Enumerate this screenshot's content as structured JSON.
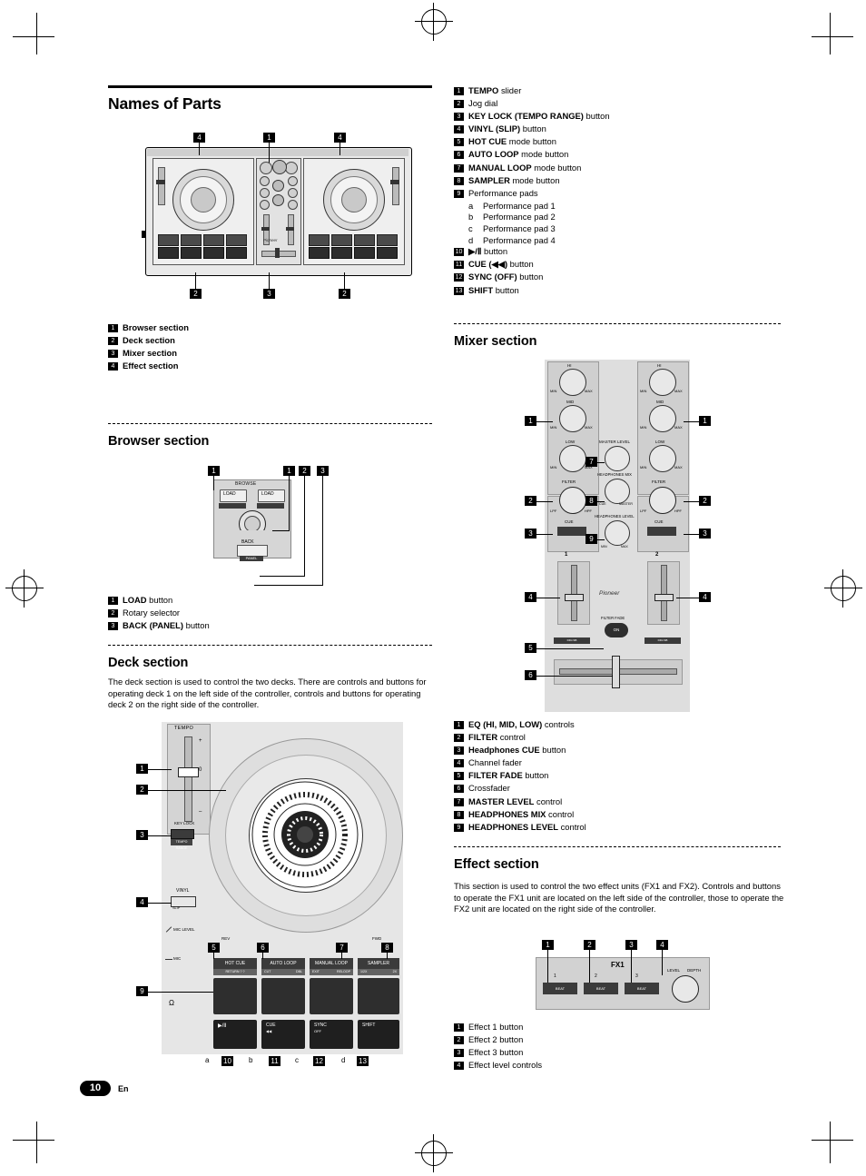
{
  "page": {
    "number": "10",
    "language": "En",
    "title": "Names of Parts"
  },
  "overview": {
    "callouts_top": [
      "4",
      "1",
      "4"
    ],
    "callouts_bottom": [
      "2",
      "3",
      "2"
    ],
    "brand": "Pioneer",
    "items": [
      {
        "num": "1",
        "label": "Browser section"
      },
      {
        "num": "2",
        "label": "Deck section"
      },
      {
        "num": "3",
        "label": "Mixer section"
      },
      {
        "num": "4",
        "label": "Effect section"
      }
    ]
  },
  "browser": {
    "title": "Browser section",
    "callouts": [
      "1",
      "1",
      "2",
      "3"
    ],
    "fig_labels": {
      "browse": "BROWSE",
      "load_left": "LOAD",
      "load_right": "LOAD",
      "back": "BACK",
      "panel": "PANEL"
    },
    "items": [
      {
        "num": "1",
        "bold": "LOAD",
        "rest": " button"
      },
      {
        "num": "2",
        "bold": "",
        "rest": "Rotary selector"
      },
      {
        "num": "3",
        "bold": "BACK (PANEL)",
        "rest": " button"
      }
    ]
  },
  "deck": {
    "title": "Deck section",
    "intro": "The deck section is used to control the two decks. There are controls and buttons for operating deck 1 on the left side of the controller, controls and buttons for operating deck 2 on the right side of the controller.",
    "fig_labels": {
      "tempo": "TEMPO",
      "plus": "+",
      "zero": "0",
      "minus": "–",
      "key_lock": "KEY LOCK",
      "tempo_range": "TEMPO RANGE",
      "vinyl": "VINYL",
      "slip": "SLIP",
      "mic_level": "MIC LEVEL",
      "mic": "MIC",
      "rev": "REV",
      "fwd": "FWD",
      "hot_cue": "HOT CUE",
      "auto_loop": "AUTO LOOP",
      "manual_loop": "MANUAL LOOP",
      "sampler": "SAMPLER",
      "hot_cue_sub": "RETURN ? ?",
      "auto_loop_sub_l": "CUT",
      "auto_loop_sub_r": "DBL",
      "manual_loop_sub_l": "EXIT",
      "manual_loop_sub_r": "RELOOP",
      "sampler_sub_l": "1/2X",
      "sampler_sub_r": "2X",
      "play": "▶/Ⅱ",
      "cue": "CUE",
      "cue_sub": "◀◀",
      "sync": "SYNC",
      "sync_sub": "OFF",
      "shift": "SHIFT",
      "headphone_icon": "Ω"
    },
    "callouts_left": [
      "1",
      "2",
      "3",
      "4",
      "9"
    ],
    "callouts_pads": [
      "5",
      "6",
      "7",
      "8"
    ],
    "callouts_bottom": [
      "a",
      "10",
      "b",
      "11",
      "c",
      "12",
      "d",
      "13"
    ],
    "items": [
      {
        "num": "1",
        "bold": "TEMPO",
        "rest": " slider"
      },
      {
        "num": "2",
        "bold": "",
        "rest": "Jog dial"
      },
      {
        "num": "3",
        "bold": "KEY LOCK (TEMPO RANGE)",
        "rest": " button"
      },
      {
        "num": "4",
        "bold": "VINYL (SLIP)",
        "rest": " button"
      },
      {
        "num": "5",
        "bold": "HOT CUE",
        "rest": " mode button"
      },
      {
        "num": "6",
        "bold": "AUTO LOOP",
        "rest": " mode button"
      },
      {
        "num": "7",
        "bold": "MANUAL LOOP",
        "rest": " mode button"
      },
      {
        "num": "8",
        "bold": "SAMPLER",
        "rest": " mode button"
      },
      {
        "num": "9",
        "bold": "",
        "rest": "Performance pads"
      },
      {
        "num": "10",
        "bold": "▶/Ⅱ",
        "rest": " button"
      },
      {
        "num": "11",
        "bold": "CUE (◀◀)",
        "rest": " button"
      },
      {
        "num": "12",
        "bold": "SYNC (OFF)",
        "rest": " button"
      },
      {
        "num": "13",
        "bold": "SHIFT",
        "rest": " button"
      }
    ],
    "pads_sub": [
      {
        "letter": "a",
        "label": "Performance pad 1"
      },
      {
        "letter": "b",
        "label": "Performance pad 2"
      },
      {
        "letter": "c",
        "label": "Performance pad 3"
      },
      {
        "letter": "d",
        "label": "Performance pad 4"
      }
    ]
  },
  "mixer": {
    "title": "Mixer section",
    "fig_labels": {
      "hi": "HI",
      "mid": "MID",
      "low": "LOW",
      "min": "MIN",
      "max": "MAX",
      "filter": "FILTER",
      "lpf": "LPF",
      "hpf": "HPF",
      "cue": "CUE",
      "master_level": "MASTER LEVEL",
      "headphones_mix": "HEADPHONES MIX",
      "cue_small": "CUE",
      "master_small": "MASTER",
      "headphones_level": "HEADPHONES LEVEL",
      "deck1": "1",
      "deck2": "2",
      "filter_fade": "FILTER FADE",
      "on": "ON",
      "brand": "Pioneer",
      "xfader_left": "DDJ-SB",
      "xfader_right": "DDJ-SB"
    },
    "callouts": [
      "1",
      "1",
      "2",
      "2",
      "3",
      "3",
      "4",
      "4",
      "5",
      "6",
      "7",
      "8",
      "9"
    ],
    "items": [
      {
        "num": "1",
        "bold": "EQ (HI, MID, LOW)",
        "rest": " controls"
      },
      {
        "num": "2",
        "bold": "FILTER",
        "rest": " control"
      },
      {
        "num": "3",
        "bold": "Headphones CUE",
        "rest": " button"
      },
      {
        "num": "4",
        "bold": "",
        "rest": "Channel fader"
      },
      {
        "num": "5",
        "bold": "FILTER FADE",
        "rest": " button"
      },
      {
        "num": "6",
        "bold": "",
        "rest": "Crossfader"
      },
      {
        "num": "7",
        "bold": "MASTER LEVEL",
        "rest": " control"
      },
      {
        "num": "8",
        "bold": "HEADPHONES MIX",
        "rest": " control"
      },
      {
        "num": "9",
        "bold": "HEADPHONES LEVEL",
        "rest": " control"
      }
    ]
  },
  "effect": {
    "title": "Effect section",
    "intro": "This section is used to control the two effect units (FX1 and FX2). Controls and buttons to operate the FX1 unit are located on the left side of the controller, those to operate the FX2 unit are located on the right side of the controller.",
    "fig_labels": {
      "fx1": "FX1",
      "level": "LEVEL",
      "depth": "DEPTH",
      "slot1": "1",
      "slot2": "2",
      "slot3": "3",
      "btn1": "BEAT",
      "btn2": "BEAT",
      "btn3": "BEAT"
    },
    "callouts": [
      "1",
      "2",
      "3",
      "4"
    ],
    "items": [
      {
        "num": "1",
        "bold": "",
        "rest": "Effect 1 button"
      },
      {
        "num": "2",
        "bold": "",
        "rest": "Effect 2 button"
      },
      {
        "num": "3",
        "bold": "",
        "rest": "Effect 3 button"
      },
      {
        "num": "4",
        "bold": "",
        "rest": "Effect level controls"
      }
    ]
  }
}
